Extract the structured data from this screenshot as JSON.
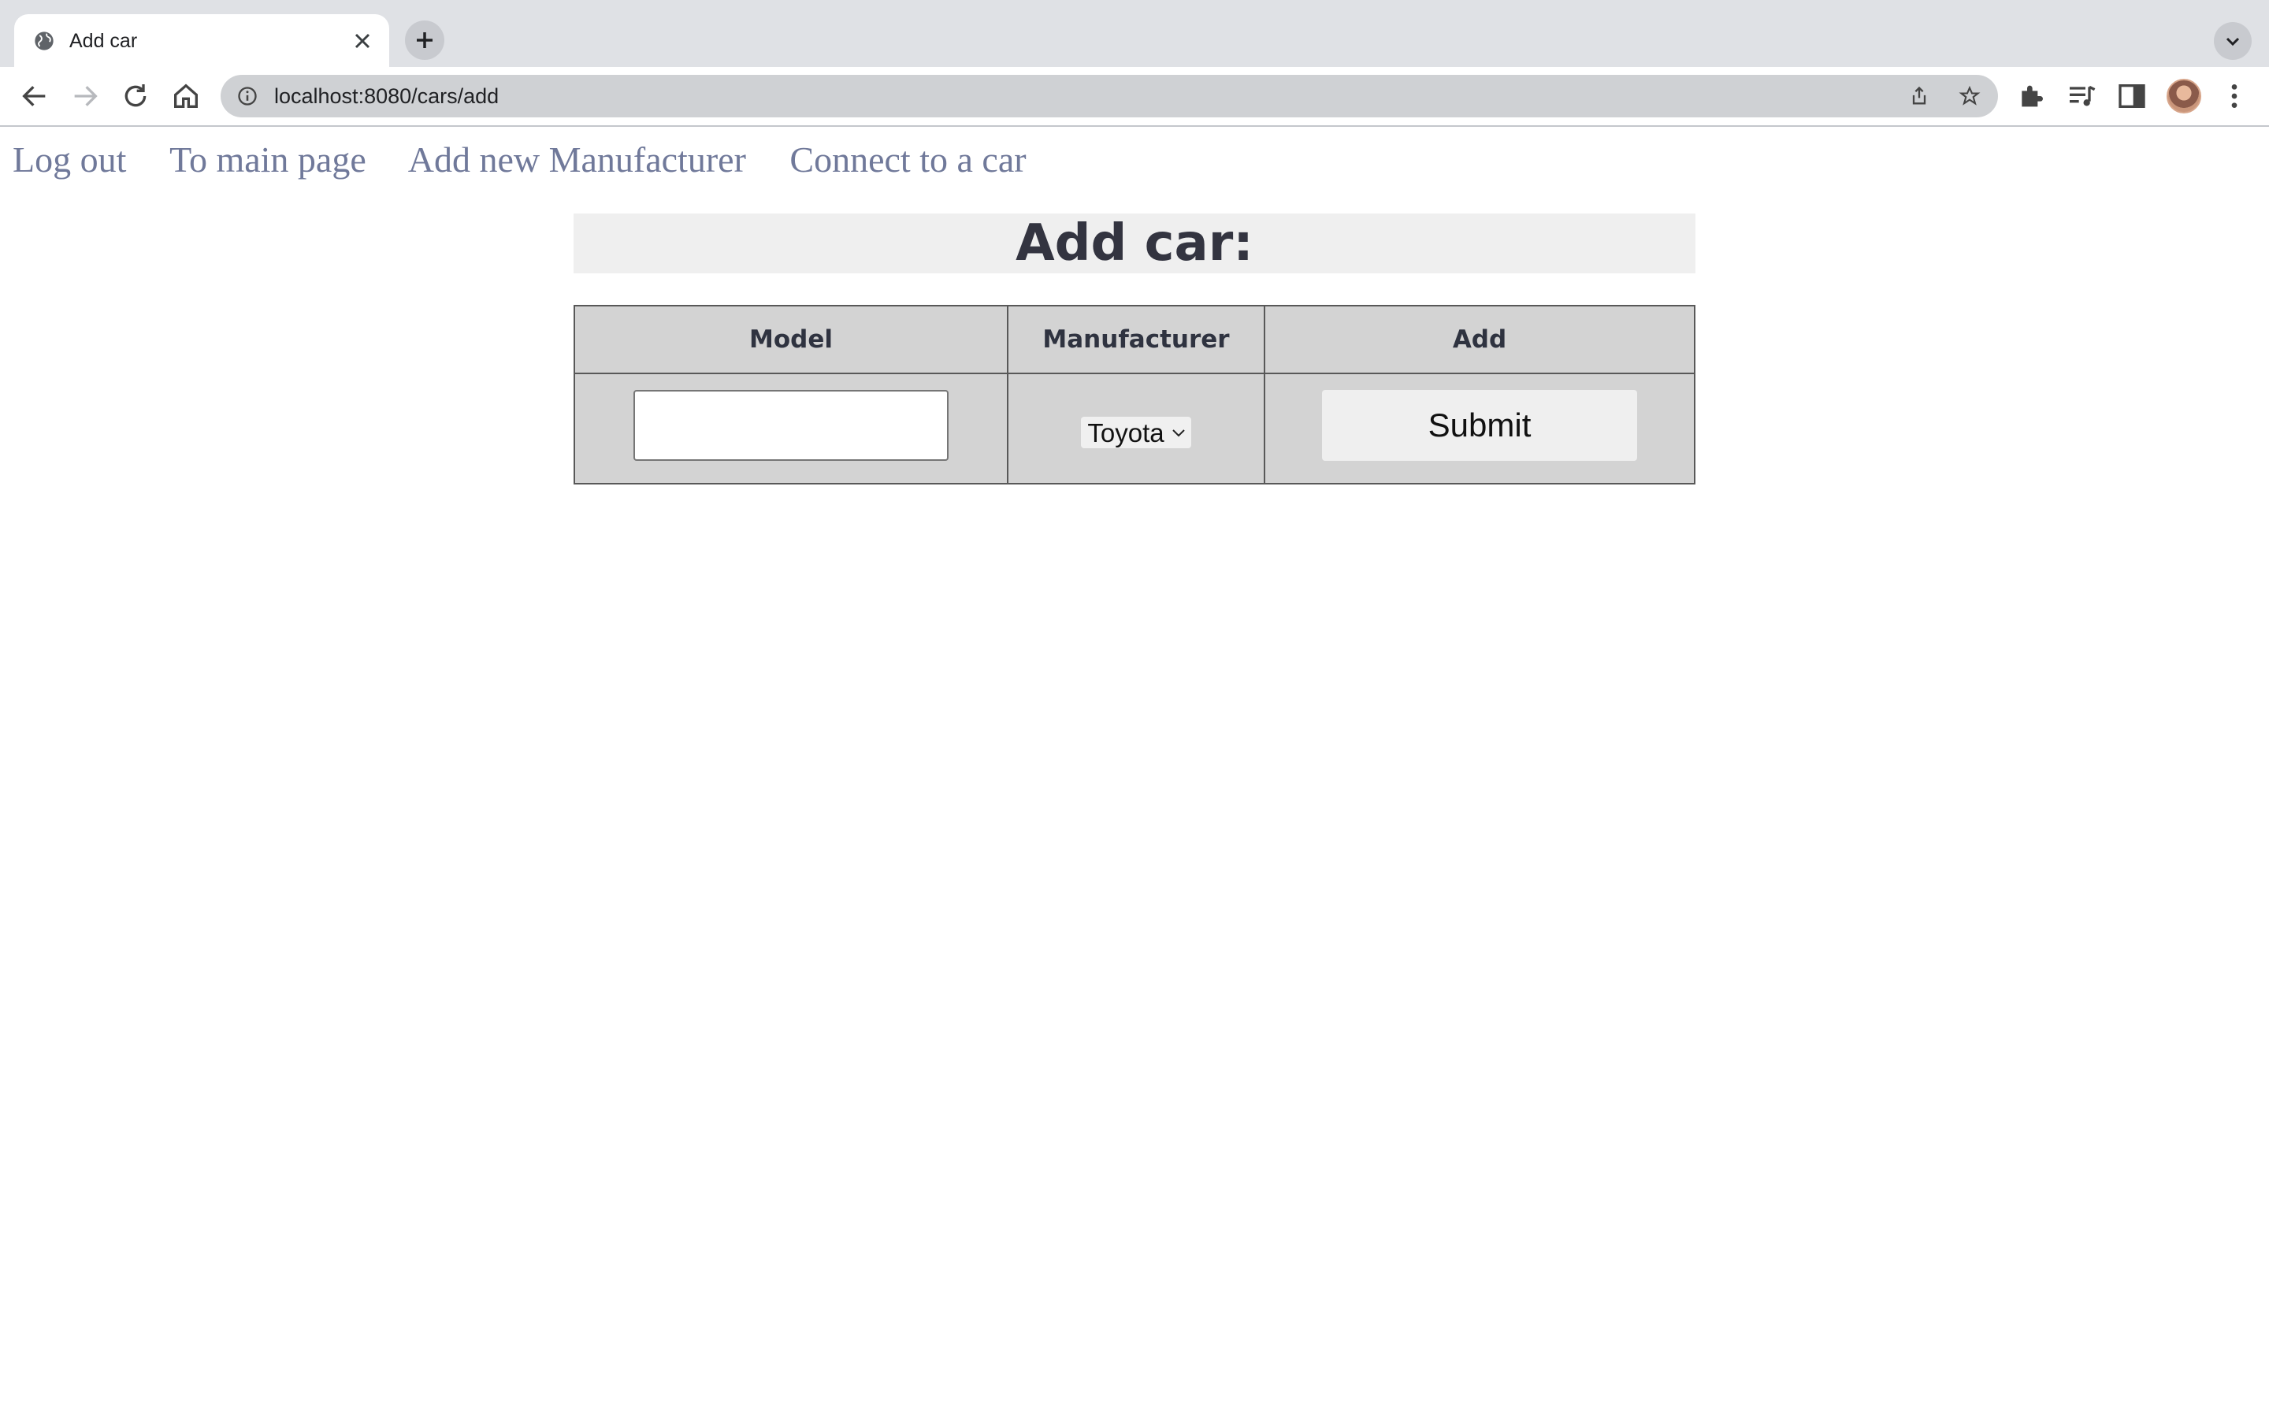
{
  "browser": {
    "tab_title": "Add car",
    "url": "localhost:8080/cars/add"
  },
  "nav": {
    "links": [
      {
        "label": "Log out"
      },
      {
        "label": "To main page"
      },
      {
        "label": "Add new Manufacturer"
      },
      {
        "label": "Connect to a car"
      }
    ]
  },
  "page": {
    "heading": "Add car:"
  },
  "form": {
    "headers": [
      "Model",
      "Manufacturer",
      "Add"
    ],
    "model_value": "",
    "manufacturer_selected": "Toyota",
    "submit_label": "Submit"
  },
  "colors": {
    "link": "#70799a",
    "heading_text": "#333440",
    "table_bg": "#d3d3d3",
    "heading_bg": "#efefef"
  }
}
